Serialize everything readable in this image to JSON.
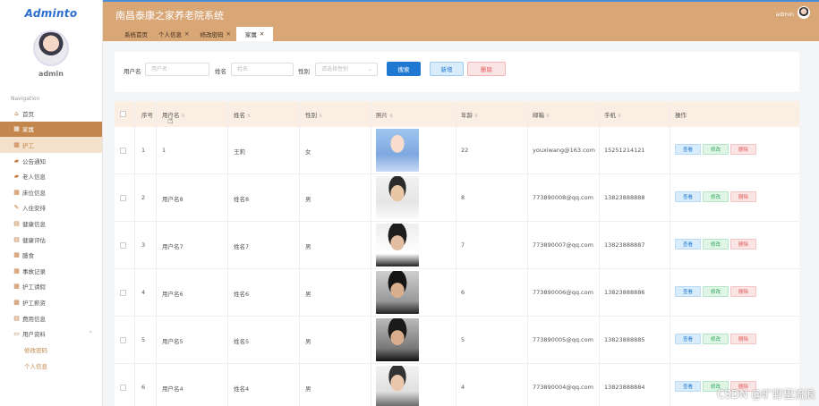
{
  "sidebar": {
    "logo": "Adminto",
    "username": "admin",
    "nav_title": "Navigation",
    "items": [
      {
        "label": "首页",
        "icon": "home-icon"
      },
      {
        "label": "家属",
        "icon": "grid-icon"
      },
      {
        "label": "护工",
        "icon": "grid-icon"
      },
      {
        "label": "公告通知",
        "icon": "bag-icon"
      },
      {
        "label": "老人信息",
        "icon": "bag-icon"
      },
      {
        "label": "床位信息",
        "icon": "grid-icon"
      },
      {
        "label": "入住安排",
        "icon": "pencil-icon"
      },
      {
        "label": "健康信息",
        "icon": "book-icon"
      },
      {
        "label": "健康评估",
        "icon": "book-icon"
      },
      {
        "label": "膳食",
        "icon": "grid-icon"
      },
      {
        "label": "事故记录",
        "icon": "grid-icon"
      },
      {
        "label": "护工请假",
        "icon": "grid-icon"
      },
      {
        "label": "护工薪资",
        "icon": "grid-icon"
      },
      {
        "label": "费用信息",
        "icon": "book-icon"
      },
      {
        "label": "用户资料",
        "icon": "card-icon"
      }
    ],
    "sub_items": [
      {
        "label": "修改密码"
      },
      {
        "label": "个人信息"
      }
    ]
  },
  "header": {
    "system_title": "南昌泰康之家养老院系统",
    "admin_label": "admin"
  },
  "tabs": [
    {
      "label": "系统首页"
    },
    {
      "label": "个人信息"
    },
    {
      "label": "修改密码"
    },
    {
      "label": "家属"
    }
  ],
  "search": {
    "username_label": "用户名",
    "username_placeholder": "用户名",
    "name_label": "姓名",
    "name_placeholder": "姓名",
    "gender_label": "性别",
    "gender_placeholder": "请选择性别",
    "search_button": "搜索",
    "add_button": "新增",
    "delete_button": "删除"
  },
  "table": {
    "columns": [
      "序号",
      "用户名",
      "姓名",
      "性别",
      "照片",
      "年龄",
      "邮箱",
      "手机",
      "操作"
    ],
    "actions": {
      "view": "查看",
      "edit": "修改",
      "delete": "删除"
    },
    "rows": [
      {
        "no": "1",
        "username": "1",
        "name": "王莉",
        "gender": "女",
        "age": "22",
        "email": "youxiwang@163.com",
        "phone": "15251214121"
      },
      {
        "no": "2",
        "username": "用户名8",
        "name": "姓名8",
        "gender": "男",
        "age": "8",
        "email": "773890008@qq.com",
        "phone": "13823888888"
      },
      {
        "no": "3",
        "username": "用户名7",
        "name": "姓名7",
        "gender": "男",
        "age": "7",
        "email": "773890007@qq.com",
        "phone": "13823888887"
      },
      {
        "no": "4",
        "username": "用户名6",
        "name": "姓名6",
        "gender": "男",
        "age": "6",
        "email": "773890006@qq.com",
        "phone": "13823888886"
      },
      {
        "no": "5",
        "username": "用户名5",
        "name": "姓名5",
        "gender": "男",
        "age": "5",
        "email": "773890005@qq.com",
        "phone": "13823888885"
      },
      {
        "no": "6",
        "username": "用户名4",
        "name": "姓名4",
        "gender": "男",
        "age": "4",
        "email": "773890004@qq.com",
        "phone": "13823888884"
      }
    ]
  },
  "watermark": "CSDN @旷野里流浪",
  "colors": {
    "accent": "#d9a676",
    "active": "#c3864c",
    "primary": "#1f78d1"
  }
}
